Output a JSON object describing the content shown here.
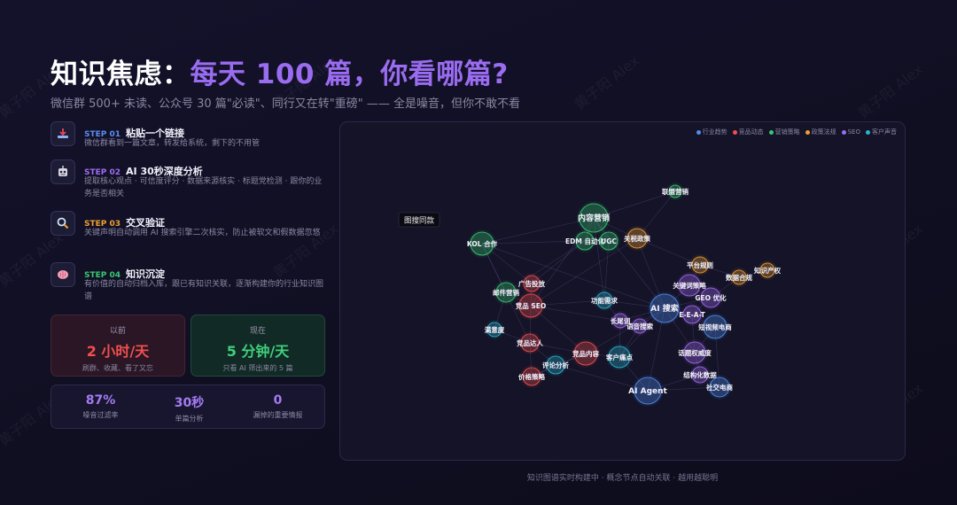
{
  "header": {
    "title_main": "知识焦虑：",
    "title_accent": "每天 100 篇，你看哪篇?",
    "subtitle": "微信群 500+ 未读、公众号 30 篇\"必读\"、同行又在转\"重磅\" —— 全是噪音，但你不敢不看"
  },
  "steps": [
    {
      "num": "STEP 01",
      "title": "粘贴一个链接",
      "desc": "微信群看到一篇文章，转发给系统，剩下的不用管",
      "color": "#5b8def",
      "icon": "download-tray-icon"
    },
    {
      "num": "STEP 02",
      "title": "AI 30秒深度分析",
      "desc": "提取核心观点 · 可信度评分 · 数据来源核实 · 标题党检测 · 跟你的业务是否相关",
      "color": "#a06cf2",
      "icon": "robot-icon"
    },
    {
      "num": "STEP 03",
      "title": "交叉验证",
      "desc": "关键声明自动调用 AI 搜索引擎二次核实，防止被软文和假数据忽悠",
      "color": "#f0a030",
      "icon": "magnifier-icon"
    },
    {
      "num": "STEP 04",
      "title": "知识沉淀",
      "desc": "有价值的自动归档入库，跟已有知识关联，逐渐构建你的行业知识图谱",
      "color": "#38c872",
      "icon": "brain-icon"
    }
  ],
  "compare": {
    "before": {
      "label": "以前",
      "value": "2 小时/天",
      "note": "刷群、收藏、看了又忘"
    },
    "after": {
      "label": "现在",
      "value": "5 分钟/天",
      "note": "只看 AI 筛出来的 5 篇"
    }
  },
  "stats": [
    {
      "value": "87%",
      "label": "噪音过滤率"
    },
    {
      "value": "30秒",
      "label": "单篇分析"
    },
    {
      "value": "0",
      "label": "漏掉的重要情报"
    }
  ],
  "legend": [
    {
      "label": "行业趋势",
      "color": "#4f8ff0"
    },
    {
      "label": "竞品动态",
      "color": "#f05050"
    },
    {
      "label": "营销策略",
      "color": "#38c872"
    },
    {
      "label": "政策法规",
      "color": "#f0a030"
    },
    {
      "label": "SEO",
      "color": "#a06cf2"
    },
    {
      "label": "客户声音",
      "color": "#28b8d0"
    }
  ],
  "tooltip": "图搜同款",
  "nodes": [
    {
      "id": "lianmeng",
      "label": "联盟营销",
      "cat": "营销策略"
    },
    {
      "id": "neirong",
      "label": "内容营销",
      "cat": "营销策略"
    },
    {
      "id": "edm",
      "label": "EDM 自动化",
      "cat": "营销策略"
    },
    {
      "id": "ugc",
      "label": "UGC",
      "cat": "营销策略"
    },
    {
      "id": "guanshui",
      "label": "关税政策",
      "cat": "政策法规"
    },
    {
      "id": "kol",
      "label": "KOL 合作",
      "cat": "营销策略"
    },
    {
      "id": "pingtai",
      "label": "平台规则",
      "cat": "政策法规"
    },
    {
      "id": "shujuhegui",
      "label": "数据合规",
      "cat": "政策法规"
    },
    {
      "id": "zhishichanquan",
      "label": "知识产权",
      "cat": "政策法规"
    },
    {
      "id": "guanggao",
      "label": "广告投放",
      "cat": "竞品动态"
    },
    {
      "id": "youjian",
      "label": "邮件营销",
      "cat": "营销策略"
    },
    {
      "id": "guanjianci",
      "label": "关键词策略",
      "cat": "SEO"
    },
    {
      "id": "geo",
      "label": "GEO 优化",
      "cat": "SEO"
    },
    {
      "id": "gongneng",
      "label": "功能需求",
      "cat": "客户声音"
    },
    {
      "id": "aisousuo",
      "label": "AI 搜索",
      "cat": "行业趋势"
    },
    {
      "id": "jingpinseo",
      "label": "竞品 SEO",
      "cat": "竞品动态"
    },
    {
      "id": "eeat",
      "label": "E-E-A-T",
      "cat": "SEO"
    },
    {
      "id": "changweici",
      "label": "长尾词",
      "cat": "SEO"
    },
    {
      "id": "yuyin",
      "label": "语音搜索",
      "cat": "SEO"
    },
    {
      "id": "duanshipin",
      "label": "短视频电商",
      "cat": "行业趋势"
    },
    {
      "id": "manyidu",
      "label": "满意度",
      "cat": "客户声音"
    },
    {
      "id": "daren",
      "label": "竞品达人",
      "cat": "竞品动态"
    },
    {
      "id": "huatiquanwei",
      "label": "话题权威度",
      "cat": "SEO"
    },
    {
      "id": "jingpinneirong",
      "label": "竞品内容",
      "cat": "竞品动态"
    },
    {
      "id": "kehutongdian",
      "label": "客户痛点",
      "cat": "客户声音"
    },
    {
      "id": "pinglun",
      "label": "评论分析",
      "cat": "客户声音"
    },
    {
      "id": "jiegouhua",
      "label": "结构化数据",
      "cat": "SEO"
    },
    {
      "id": "jiage",
      "label": "价格策略",
      "cat": "竞品动态"
    },
    {
      "id": "aiagent",
      "label": "AI Agent",
      "cat": "行业趋势"
    },
    {
      "id": "shejiao",
      "label": "社交电商",
      "cat": "行业趋势"
    }
  ],
  "edges": [
    [
      "kol",
      "neirong"
    ],
    [
      "kol",
      "edm"
    ],
    [
      "kol",
      "guanggao"
    ],
    [
      "kol",
      "youjian"
    ],
    [
      "kol",
      "aisousuo"
    ],
    [
      "kol",
      "daren"
    ],
    [
      "neirong",
      "edm"
    ],
    [
      "neirong",
      "ugc"
    ],
    [
      "neirong",
      "guanshui"
    ],
    [
      "neirong",
      "gongneng"
    ],
    [
      "neirong",
      "aisousuo"
    ],
    [
      "neirong",
      "jingpinseo"
    ],
    [
      "lianmeng",
      "neirong"
    ],
    [
      "lianmeng",
      "guanshui"
    ],
    [
      "guanshui",
      "aisousuo"
    ],
    [
      "guanshui",
      "pingtai"
    ],
    [
      "guanshui",
      "jingpinseo"
    ],
    [
      "edm",
      "youjian"
    ],
    [
      "edm",
      "guanggao"
    ],
    [
      "ugc",
      "gongneng"
    ],
    [
      "pingtai",
      "guanjianci"
    ],
    [
      "pingtai",
      "shujuhegui"
    ],
    [
      "shujuhegui",
      "zhishichanquan"
    ],
    [
      "shujuhegui",
      "geo"
    ],
    [
      "guanggao",
      "jingpinseo"
    ],
    [
      "youjian",
      "jingpinseo"
    ],
    [
      "youjian",
      "manyidu"
    ],
    [
      "jingpinseo",
      "gongneng"
    ],
    [
      "jingpinseo",
      "daren"
    ],
    [
      "jingpinseo",
      "jingpinneirong"
    ],
    [
      "jingpinseo",
      "changweici"
    ],
    [
      "guanjianci",
      "aisousuo"
    ],
    [
      "guanjianci",
      "geo"
    ],
    [
      "geo",
      "aisousuo"
    ],
    [
      "geo",
      "eeat"
    ],
    [
      "aisousuo",
      "eeat"
    ],
    [
      "aisousuo",
      "changweici"
    ],
    [
      "aisousuo",
      "yuyin"
    ],
    [
      "aisousuo",
      "duanshipin"
    ],
    [
      "aisousuo",
      "gongneng"
    ],
    [
      "aisousuo",
      "kehutongdian"
    ],
    [
      "aisousuo",
      "huatiquanwei"
    ],
    [
      "aisousuo",
      "aiagent"
    ],
    [
      "aisousuo",
      "jingpinneirong"
    ],
    [
      "eeat",
      "duanshipin"
    ],
    [
      "eeat",
      "huatiquanwei"
    ],
    [
      "changweici",
      "yuyin"
    ],
    [
      "changweici",
      "kehutongdian"
    ],
    [
      "changweici",
      "gongneng"
    ],
    [
      "daren",
      "jingpinneirong"
    ],
    [
      "daren",
      "pinglun"
    ],
    [
      "daren",
      "jiage"
    ],
    [
      "daren",
      "manyidu"
    ],
    [
      "jingpinneirong",
      "kehutongdian"
    ],
    [
      "jingpinneirong",
      "pinglun"
    ],
    [
      "jingpinneirong",
      "jiage"
    ],
    [
      "kehutongdian",
      "aiagent"
    ],
    [
      "kehutongdian",
      "yuyin"
    ],
    [
      "huatiquanwei",
      "jiegouhua"
    ],
    [
      "jiegouhua",
      "shejiao"
    ],
    [
      "jiegouhua",
      "aiagent"
    ],
    [
      "shejiao",
      "aiagent"
    ],
    [
      "shejiao",
      "duanshipin"
    ],
    [
      "pinglun",
      "aiagent"
    ],
    [
      "pinglun",
      "jiage"
    ],
    [
      "duanshipin",
      "huatiquanwei"
    ]
  ],
  "footer": "知识图谱实时构建中 · 概念节点自动关联 · 越用越聪明"
}
